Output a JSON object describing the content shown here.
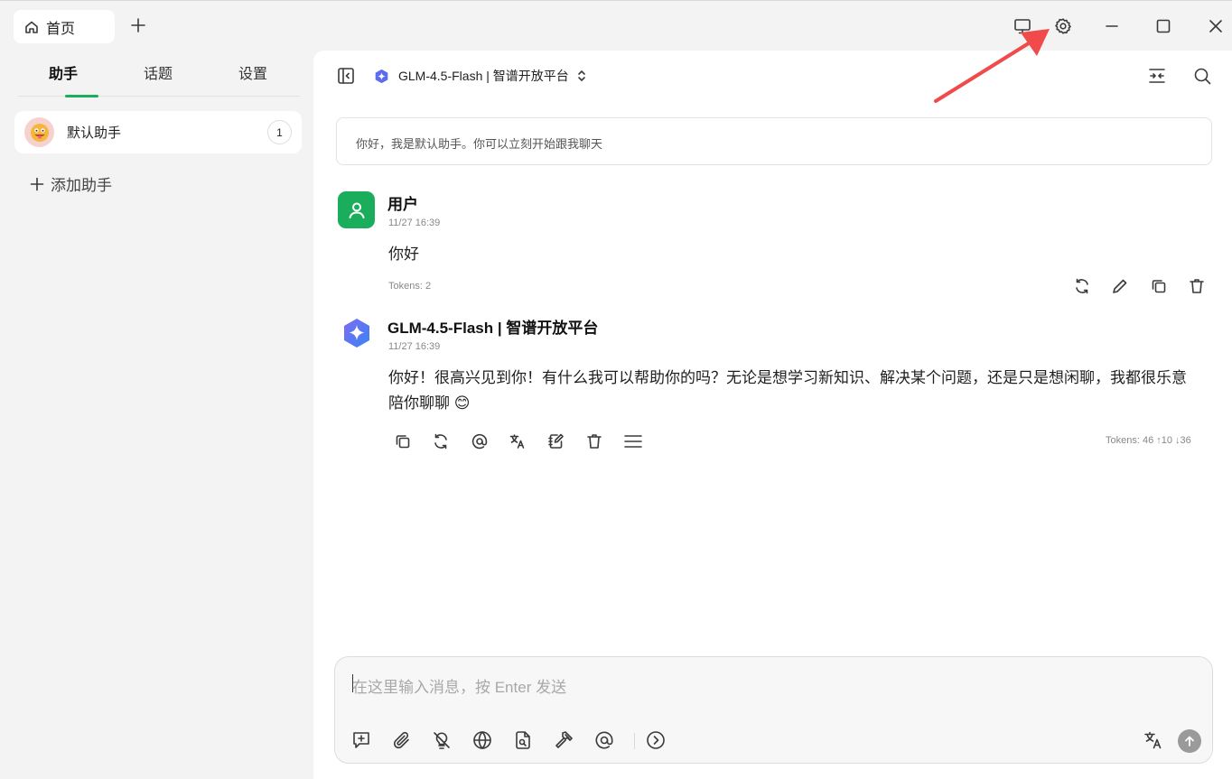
{
  "titlebar": {
    "home_tab_label": "首页",
    "icons": [
      "home-icon",
      "plus-icon",
      "monitor-icon",
      "gear-icon",
      "minimize-icon",
      "maximize-icon",
      "close-icon"
    ]
  },
  "sidebar": {
    "tabs": [
      {
        "label": "助手",
        "active": true
      },
      {
        "label": "话题",
        "active": false
      },
      {
        "label": "设置",
        "active": false
      }
    ],
    "assistants": [
      {
        "name": "默认助手",
        "count": "1"
      }
    ],
    "add_assistant_label": "添加助手"
  },
  "main": {
    "model_name": "GLM-4.5-Flash | 智谱开放平台",
    "welcome": "你好，我是默认助手。你可以立刻开始跟我聊天",
    "messages": [
      {
        "role": "user",
        "name": "用户",
        "time": "11/27 16:39",
        "text": "你好",
        "tokens": "Tokens: 2"
      },
      {
        "role": "assistant",
        "name": "GLM-4.5-Flash | 智谱开放平台",
        "time": "11/27 16:39",
        "text_line1": "你好！很高兴见到你！有什么我可以帮助你的吗？无论是想学习新知识、解决某个问题，还是只是想闲聊，我都很乐意",
        "text_line2": "陪你聊聊 😊",
        "tokens": "Tokens: 46 ↑10 ↓36"
      }
    ]
  },
  "input": {
    "placeholder": "在这里输入消息，按 Enter 发送"
  },
  "colors": {
    "accent_green": "#1aad5b",
    "annotation_arrow": "#f04a4a",
    "model_logo": "#5b6cf0"
  }
}
